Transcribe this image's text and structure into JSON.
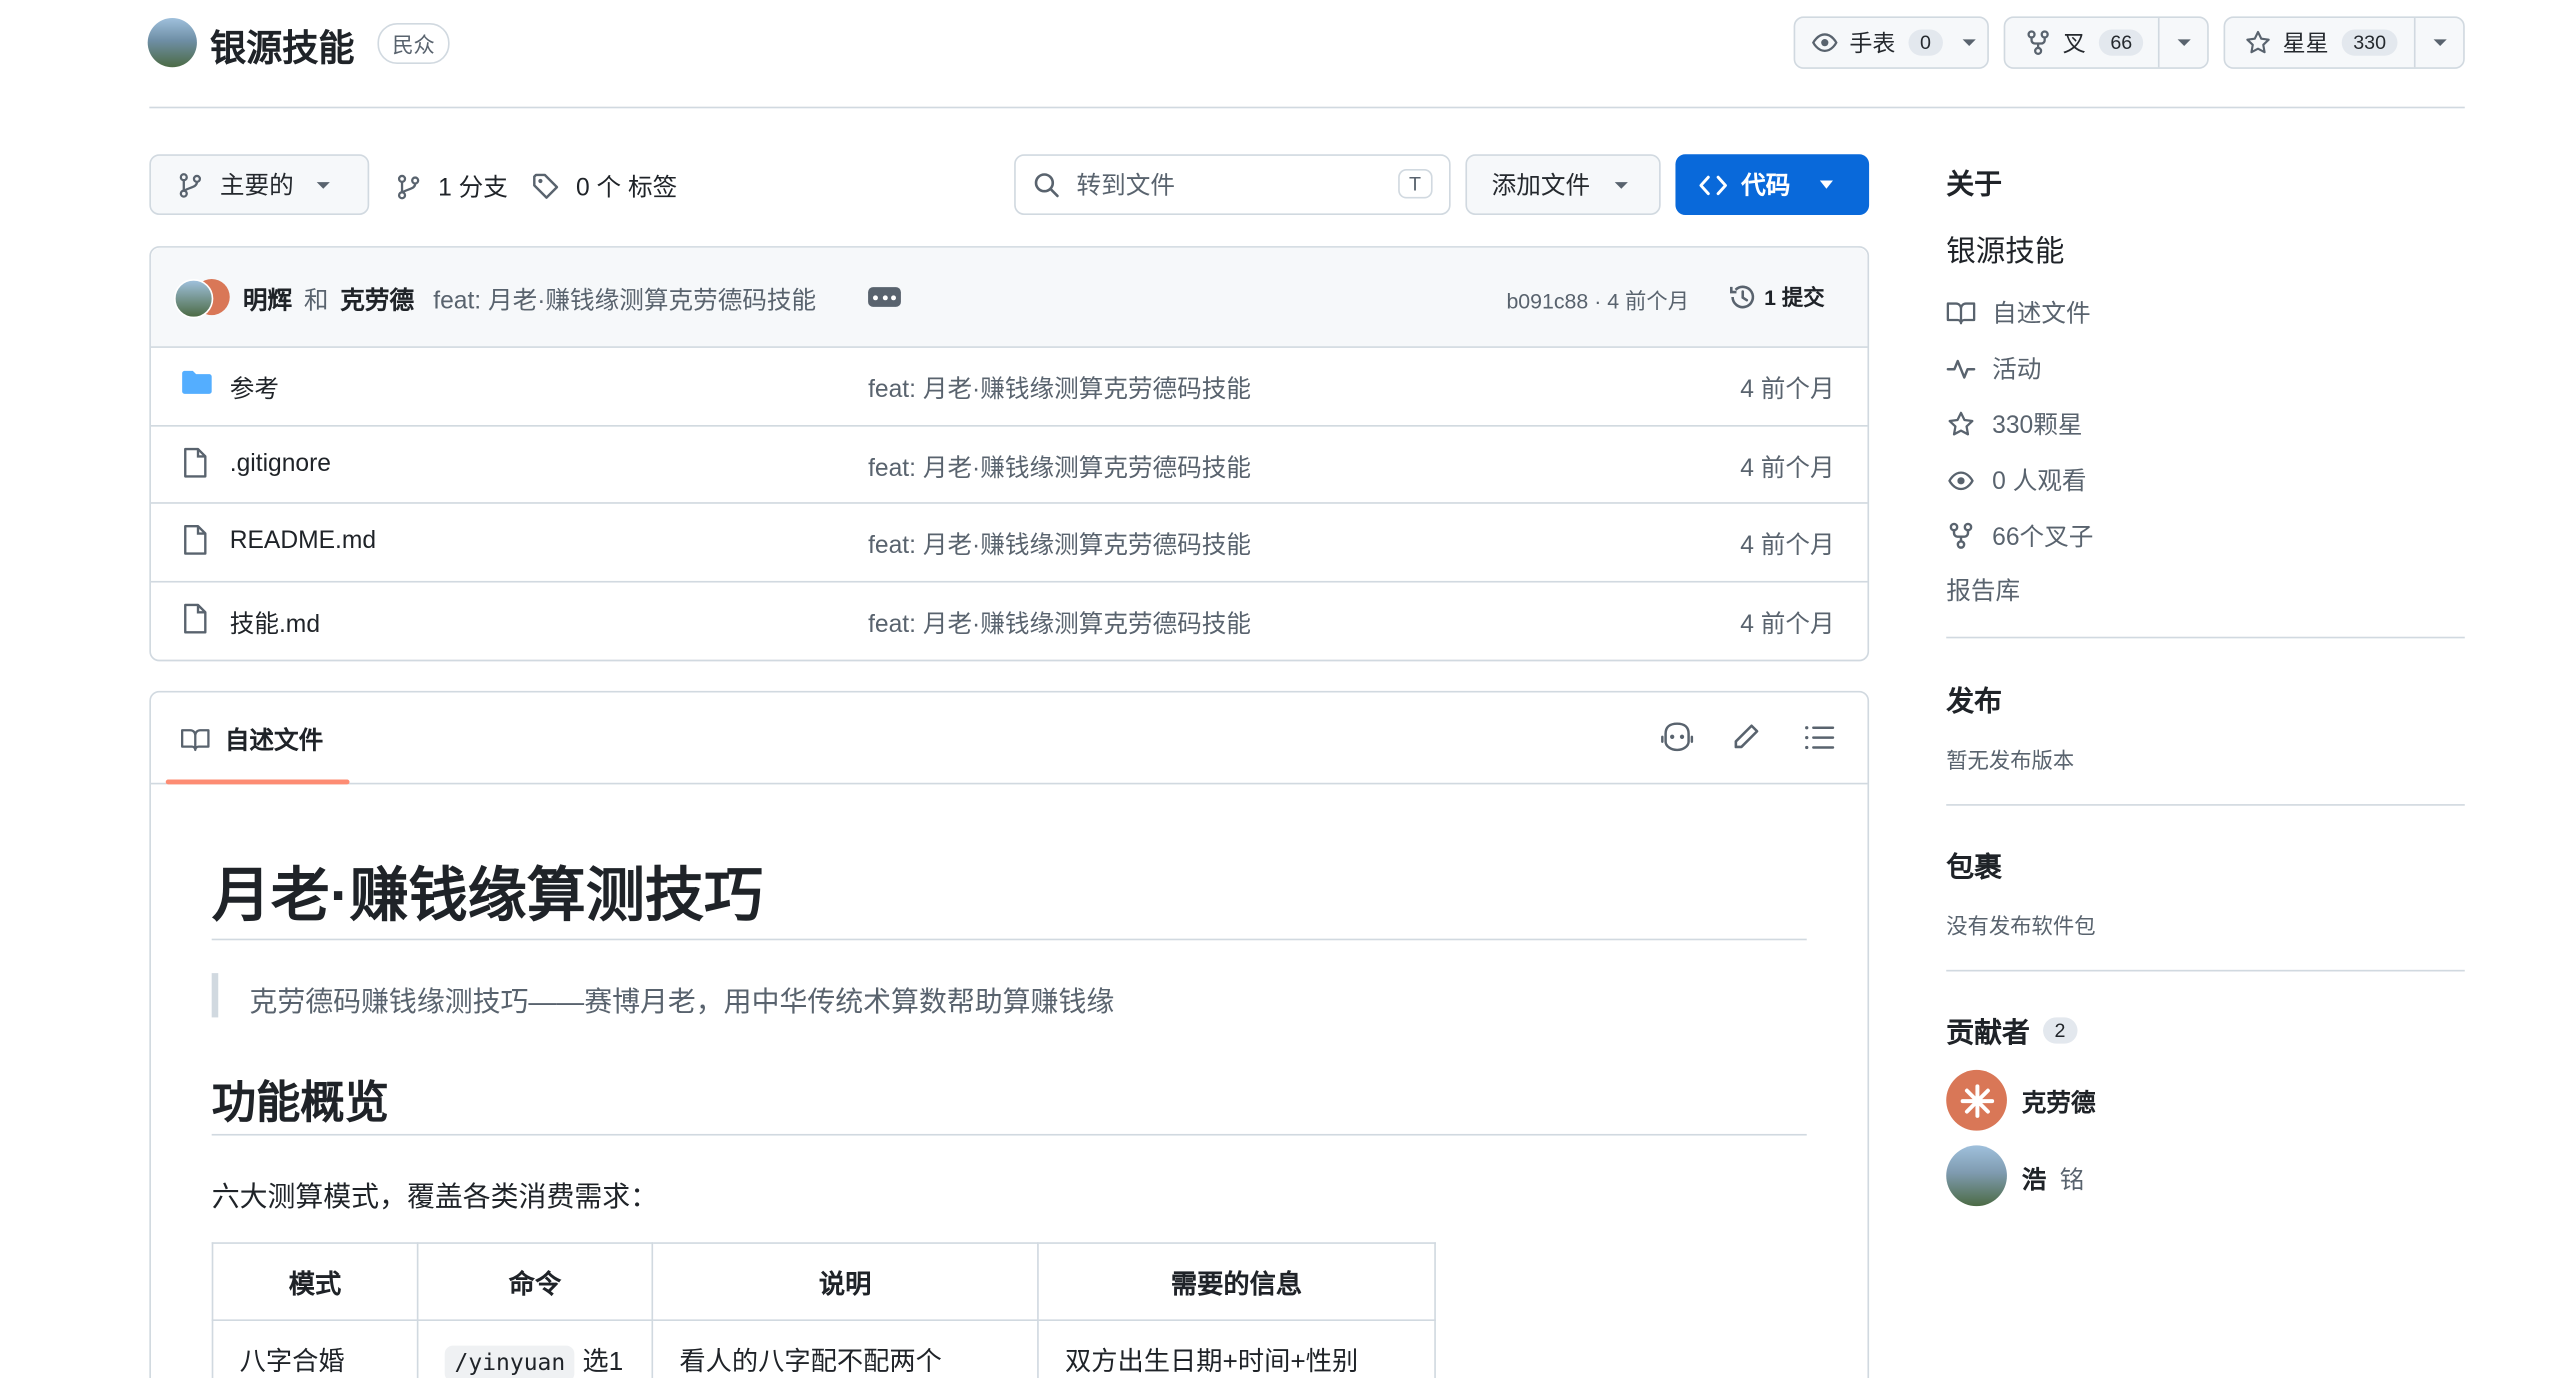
{
  "header": {
    "repo_name": "银源技能",
    "visibility": "民众",
    "watch": {
      "label": "手表",
      "count": "0"
    },
    "fork": {
      "label": "叉",
      "count": "66"
    },
    "star": {
      "label": "星星",
      "count": "330"
    }
  },
  "toolbar": {
    "branch": "主要的",
    "branches": "1 分支",
    "tags": "0 个 标签",
    "search_placeholder": "转到文件",
    "search_shortcut": "T",
    "add_file": "添加文件",
    "code": "代码"
  },
  "commit": {
    "author1": "明辉",
    "and": "和",
    "author2": "克劳德",
    "message": "feat: 月老·赚钱缘测算克劳德码技能",
    "hash_time": "b091c88 · 4 前个月",
    "commits": "1 提交"
  },
  "files": [
    {
      "name": "参考",
      "type": "folder",
      "message": "feat: 月老·赚钱缘测算克劳德码技能",
      "time": "4 前个月"
    },
    {
      "name": ".gitignore",
      "type": "file",
      "message": "feat: 月老·赚钱缘测算克劳德码技能",
      "time": "4 前个月"
    },
    {
      "name": "README.md",
      "type": "file",
      "message": "feat: 月老·赚钱缘测算克劳德码技能",
      "time": "4 前个月"
    },
    {
      "name": "技能.md",
      "type": "file",
      "message": "feat: 月老·赚钱缘测算克劳德码技能",
      "time": "4 前个月"
    }
  ],
  "readme": {
    "tab": "自述文件",
    "title": "月老·赚钱缘算测技巧",
    "quote": "克劳德码赚钱缘测技巧——赛博月老，用中华传统术算数帮助算赚钱缘",
    "h2": "功能概览",
    "intro": "六大测算模式，覆盖各类消费需求：",
    "table_headers": [
      "模式",
      "命令",
      "说明",
      "需要的信息"
    ],
    "row1": {
      "mode": "八字合婚",
      "cmd": "/yinyuan",
      "cmd_suffix": "选1",
      "desc": "看人的八字配不配两个",
      "info": "双方出生日期+时间+性别"
    }
  },
  "sidebar": {
    "about": "关于",
    "desc": "银源技能",
    "links": [
      {
        "icon": "book-icon",
        "label": "自述文件"
      },
      {
        "icon": "pulse-icon",
        "label": "活动"
      },
      {
        "icon": "star-icon",
        "label": "330颗星"
      },
      {
        "icon": "eye-icon",
        "label": "0 人观看"
      },
      {
        "icon": "fork-icon",
        "label": "66个叉子"
      }
    ],
    "report": "报告库",
    "releases_title": "发布",
    "releases_text": "暂无发布版本",
    "packages_title": "包裹",
    "packages_text": "没有发布软件包",
    "contributors_title": "贡献者",
    "contributors_count": "2",
    "contributors": [
      {
        "name": "克劳德"
      },
      {
        "name": "浩",
        "sub": "铭"
      }
    ]
  },
  "colors": {
    "accent": "#0969da",
    "underline": "#fd8c73",
    "border": "#d1d9e0",
    "claude": "#d97757"
  }
}
